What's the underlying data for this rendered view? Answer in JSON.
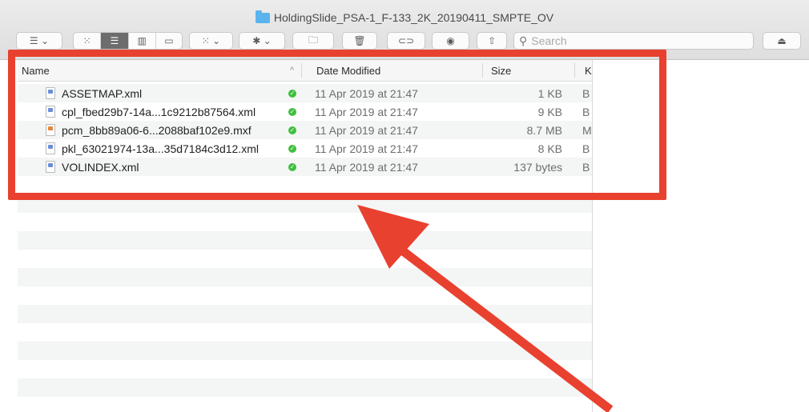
{
  "window": {
    "title": "HoldingSlide_PSA-1_F-133_2K_20190411_SMPTE_OV"
  },
  "toolbar": {
    "search_placeholder": "Search",
    "search_icon": "magnifier-icon"
  },
  "columns": {
    "name": "Name",
    "date_modified": "Date Modified",
    "size": "Size",
    "kind": "K",
    "sort_indicator": "^"
  },
  "files": [
    {
      "name": "ASSETMAP.xml",
      "date": "11 Apr 2019 at 21:47",
      "size": "1 KB",
      "kind": "B",
      "icon": "xml-file-icon"
    },
    {
      "name": "cpl_fbed29b7-14a...1c9212b87564.xml",
      "date": "11 Apr 2019 at 21:47",
      "size": "9 KB",
      "kind": "B",
      "icon": "xml-file-icon"
    },
    {
      "name": "pcm_8bb89a06-6...2088baf102e9.mxf",
      "date": "11 Apr 2019 at 21:47",
      "size": "8.7 MB",
      "kind": "M",
      "icon": "mxf-file-icon"
    },
    {
      "name": "pkl_63021974-13a...35d7184c3d12.xml",
      "date": "11 Apr 2019 at 21:47",
      "size": "8 KB",
      "kind": "B",
      "icon": "xml-file-icon"
    },
    {
      "name": "VOLINDEX.xml",
      "date": "11 Apr 2019 at 21:47",
      "size": "137 bytes",
      "kind": "B",
      "icon": "xml-file-icon"
    }
  ],
  "status_icon": "synced-check-icon",
  "colors": {
    "annotation": "#e9412f",
    "folder": "#5ab3ec",
    "status_ok": "#3ebf3e"
  }
}
